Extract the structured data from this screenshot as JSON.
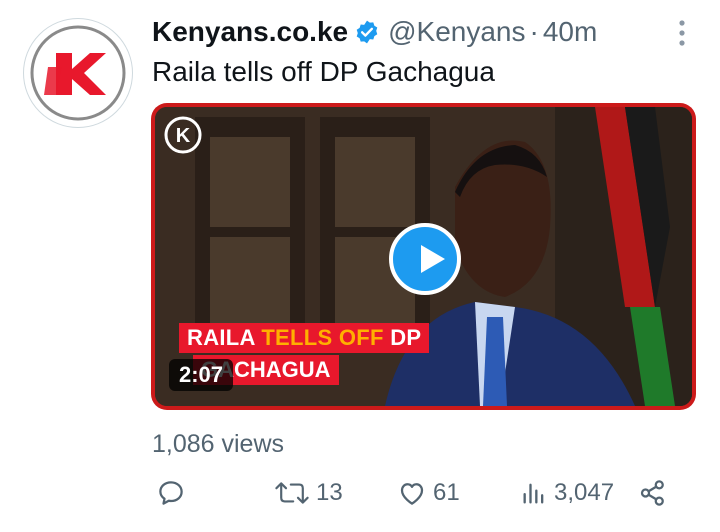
{
  "tweet": {
    "display_name": "Kenyans.co.ke",
    "handle": "@Kenyans",
    "separator": "·",
    "time": "40m",
    "text": "Raila tells off DP Gachagua",
    "views": "1,086 views"
  },
  "video": {
    "caption_line1_a": "RAILA ",
    "caption_line1_b": "TELLS OFF",
    "caption_line1_c": " DP",
    "caption_line2": "GACHAGUA",
    "duration": "2:07",
    "logo_letter": "K"
  },
  "actions": {
    "reply_count": "",
    "retweet_count": "13",
    "like_count": "61",
    "view_count": "3,047"
  },
  "colors": {
    "brand_red": "#e8182c",
    "accent_blue": "#1d9bf0",
    "muted_text": "#536471"
  }
}
